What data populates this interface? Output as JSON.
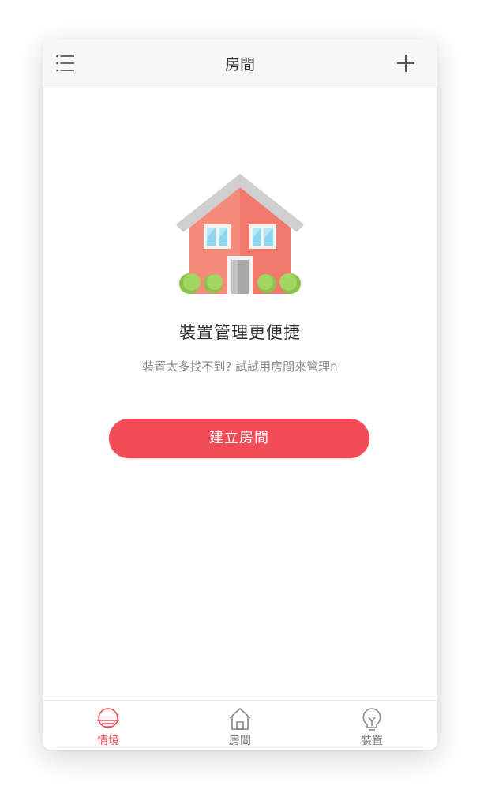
{
  "header": {
    "title": "房間",
    "menu_icon": "menu-icon",
    "add_icon": "plus-icon"
  },
  "empty_state": {
    "illustration": "house-icon",
    "title": "裝置管理更便捷",
    "subtitle": "裝置太多找不到? 試試用房間來管理n"
  },
  "actions": {
    "create_room_label": "建立房間"
  },
  "tabs": [
    {
      "label": "情境",
      "icon": "scene-icon",
      "active": true
    },
    {
      "label": "房間",
      "icon": "home-icon",
      "active": false
    },
    {
      "label": "裝置",
      "icon": "bulb-icon",
      "active": false
    }
  ],
  "colors": {
    "accent": "#f24c58",
    "nav_background": "#f7f7f7",
    "house_wall": "#f47c6c",
    "house_roof": "#cccccc",
    "window_glass": "#8dd6ec",
    "bush": "#9ccf5b"
  }
}
